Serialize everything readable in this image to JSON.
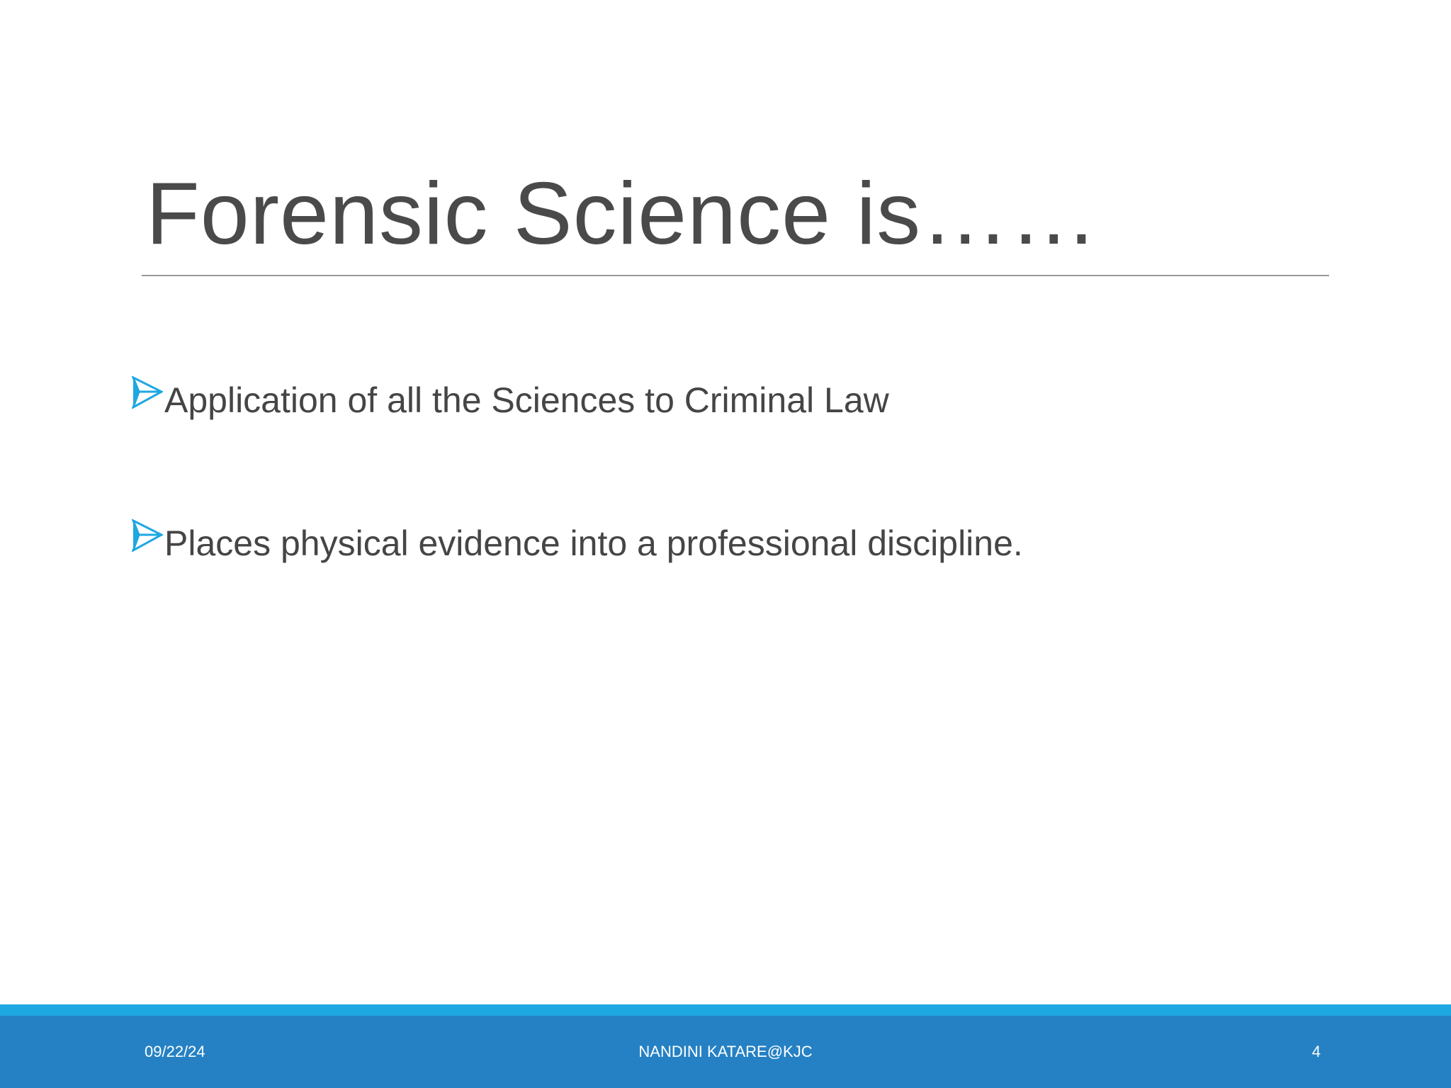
{
  "slide": {
    "title": "Forensic Science is……",
    "bullets": [
      {
        "text": "Application of all the Sciences to Criminal Law",
        "icon": "arrow-bullet-icon"
      },
      {
        "text": "Places physical evidence into a professional discipline.",
        "icon": "arrow-bullet-icon"
      }
    ]
  },
  "footer": {
    "date": "09/22/24",
    "author": "NANDINI KATARE@KJC",
    "page_number": "4"
  },
  "colors": {
    "title_text": "#4a4a4a",
    "body_text": "#454545",
    "bullet_accent": "#1ea7e1",
    "footer_stripe": "#1ea7e1",
    "footer_bar": "#2581c4"
  }
}
